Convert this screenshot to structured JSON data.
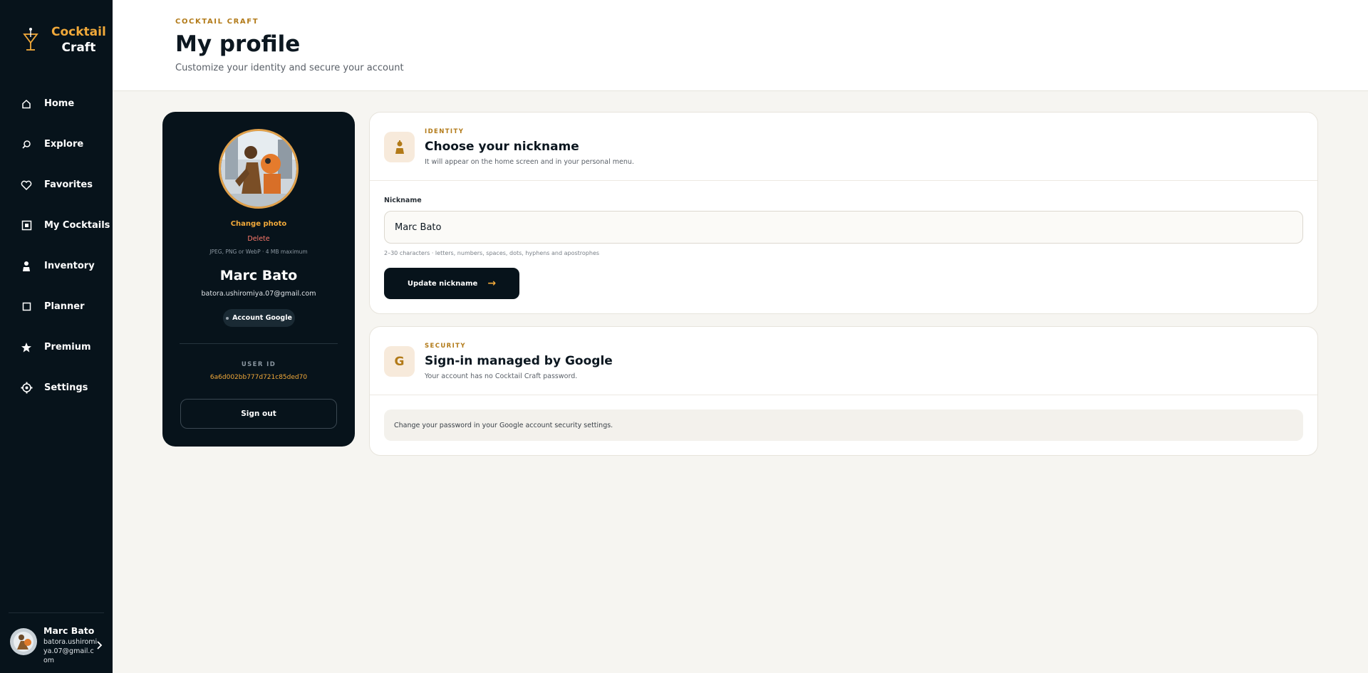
{
  "brand": {
    "line1": "Cocktail",
    "line2": "Craft"
  },
  "nav": {
    "items": [
      {
        "label": "Home",
        "icon": "home-icon"
      },
      {
        "label": "Explore",
        "icon": "search-icon"
      },
      {
        "label": "Favorites",
        "icon": "heart-icon"
      },
      {
        "label": "My Cocktails",
        "icon": "square-icon"
      },
      {
        "label": "Inventory",
        "icon": "bartender-icon"
      },
      {
        "label": "Planner",
        "icon": "calendar-icon"
      },
      {
        "label": "Premium",
        "icon": "star-icon"
      },
      {
        "label": "Settings",
        "icon": "gear-icon"
      }
    ]
  },
  "sidebar_user": {
    "name": "Marc Bato",
    "email": "batora.ushiromiya.07@gmail.com"
  },
  "header": {
    "kicker": "COCKTAIL CRAFT",
    "title": "My profile",
    "subtitle": "Customize your identity and secure your account"
  },
  "profile": {
    "change_photo": "Change photo",
    "delete": "Delete",
    "file_hint": "JPEG, PNG or WebP · 4 MB maximum",
    "name": "Marc Bato",
    "email": "batora.ushiromiya.07@gmail.com",
    "account_chip": "Account Google",
    "uid_label": "USER ID",
    "uid_value": "6a6d002bb777d721c85ded70",
    "sign_out": "Sign out"
  },
  "identity": {
    "kicker": "IDENTITY",
    "title": "Choose your nickname",
    "description": "It will appear on the home screen and in your personal menu.",
    "field_label": "Nickname",
    "nickname_value": "Marc Bato",
    "hint": "2–30 characters · letters, numbers, spaces, dots, hyphens and apostrophes",
    "button_label": "Update nickname",
    "button_arrow": "→"
  },
  "security": {
    "kicker": "SECURITY",
    "icon_letter": "G",
    "title": "Sign-in managed by Google",
    "description": "Your account has no Cocktail Craft password.",
    "note": "Change your password in your Google account security settings."
  },
  "colors": {
    "accent": "#f1a93a",
    "dark": "#07131b",
    "danger": "#ff7a6b",
    "background": "#f6f5f1"
  }
}
